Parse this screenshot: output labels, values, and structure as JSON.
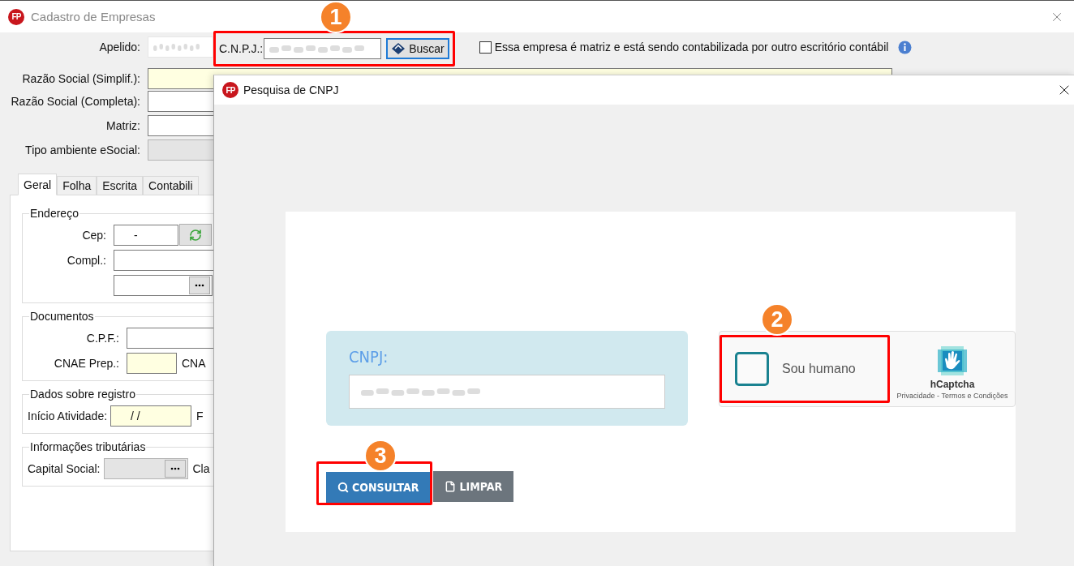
{
  "window": {
    "logo": "FP",
    "title": "Cadastro de Empresas"
  },
  "header": {
    "apelido_label": "Apelido:",
    "cnpj_label": "C.N.P.J.:",
    "search_button": "Buscar",
    "annotation": "1",
    "matriz_checkbox": {
      "label": "Essa empresa é matriz e está sendo contabilizada por outro escritório contábil",
      "checked": false
    },
    "razao_simplif_label": "Razão Social (Simplif.):"
  },
  "form_rows": [
    {
      "label": "Razão Social (Completa):",
      "disabled": false
    },
    {
      "label": "Matriz:",
      "disabled": false
    },
    {
      "label": "Tipo ambiente eSocial:",
      "disabled": true
    }
  ],
  "tabs": [
    {
      "label": "Geral",
      "selected": true
    },
    {
      "label": "Folha",
      "selected": false
    },
    {
      "label": "Escrita",
      "selected": false
    },
    {
      "label": "Contabili",
      "selected": false
    }
  ],
  "groups": [
    {
      "title": "Endereço",
      "rows": [
        {
          "kind": "zip",
          "label": "Cep:",
          "value": "-",
          "required": false,
          "disabled": false
        },
        {
          "kind": "text",
          "label": "Compl.:",
          "required": false,
          "disabled": false
        },
        {
          "kind": "lookup",
          "required": false,
          "disabled": false
        }
      ]
    },
    {
      "title": "Documentos",
      "rows": [
        {
          "kind": "text",
          "label": "C.P.F.:",
          "required": false,
          "disabled": false
        },
        {
          "kind": "code",
          "label": "CNAE Prep.:",
          "required": true,
          "disabled": false,
          "trailing": "CNA"
        }
      ]
    },
    {
      "title": "Dados sobre registro",
      "rows": [
        {
          "kind": "date",
          "label": "Início Atividade:",
          "value": "/ /",
          "required": true,
          "disabled": false,
          "trailing": "F"
        }
      ]
    },
    {
      "title": "Informações tributárias",
      "rows": [
        {
          "kind": "lookup",
          "label": "Capital Social:",
          "required": false,
          "disabled": true,
          "trailing": "Cla"
        }
      ]
    }
  ],
  "dialog": {
    "logo": "FP",
    "title": "Pesquisa de CNPJ",
    "cnpj_label": "CNPJ:",
    "captcha": {
      "label": "Sou humano",
      "checked": false,
      "brand": "hCaptcha",
      "links": "Privacidade - Termos e Condições",
      "annotation": "2"
    },
    "buttons": [
      {
        "label": "CONSULTAR",
        "kind": "primary",
        "annotation": "3"
      },
      {
        "label": "LIMPAR",
        "kind": "secondary"
      }
    ]
  }
}
